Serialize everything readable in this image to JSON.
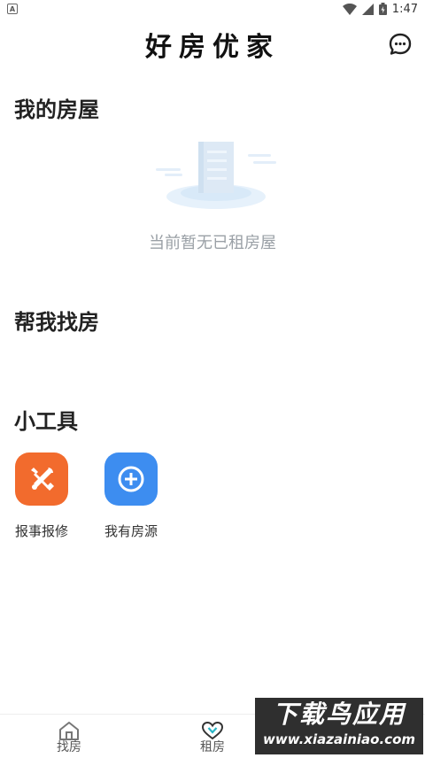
{
  "status_bar": {
    "notification_icon": "A",
    "time": "1:47"
  },
  "header": {
    "title": "好房优家",
    "message_icon": "chat-bubble-icon"
  },
  "my_house": {
    "title": "我的房屋",
    "empty_text": "当前暂无已租房屋"
  },
  "find_house": {
    "title": "帮我找房"
  },
  "tools": {
    "title": "小工具",
    "items": [
      {
        "label": "报事报修",
        "icon": "repair-tools-icon",
        "color": "#f26b2d"
      },
      {
        "label": "我有房源",
        "icon": "plus-circle-icon",
        "color": "#3d8df0"
      }
    ]
  },
  "tab_bar": {
    "tabs": [
      {
        "label": "找房",
        "icon": "house-icon"
      },
      {
        "label": "租房",
        "icon": "heart-icon"
      }
    ]
  },
  "watermark": {
    "main": "下载鸟应用",
    "sub": "www.xiazainiao.com"
  }
}
